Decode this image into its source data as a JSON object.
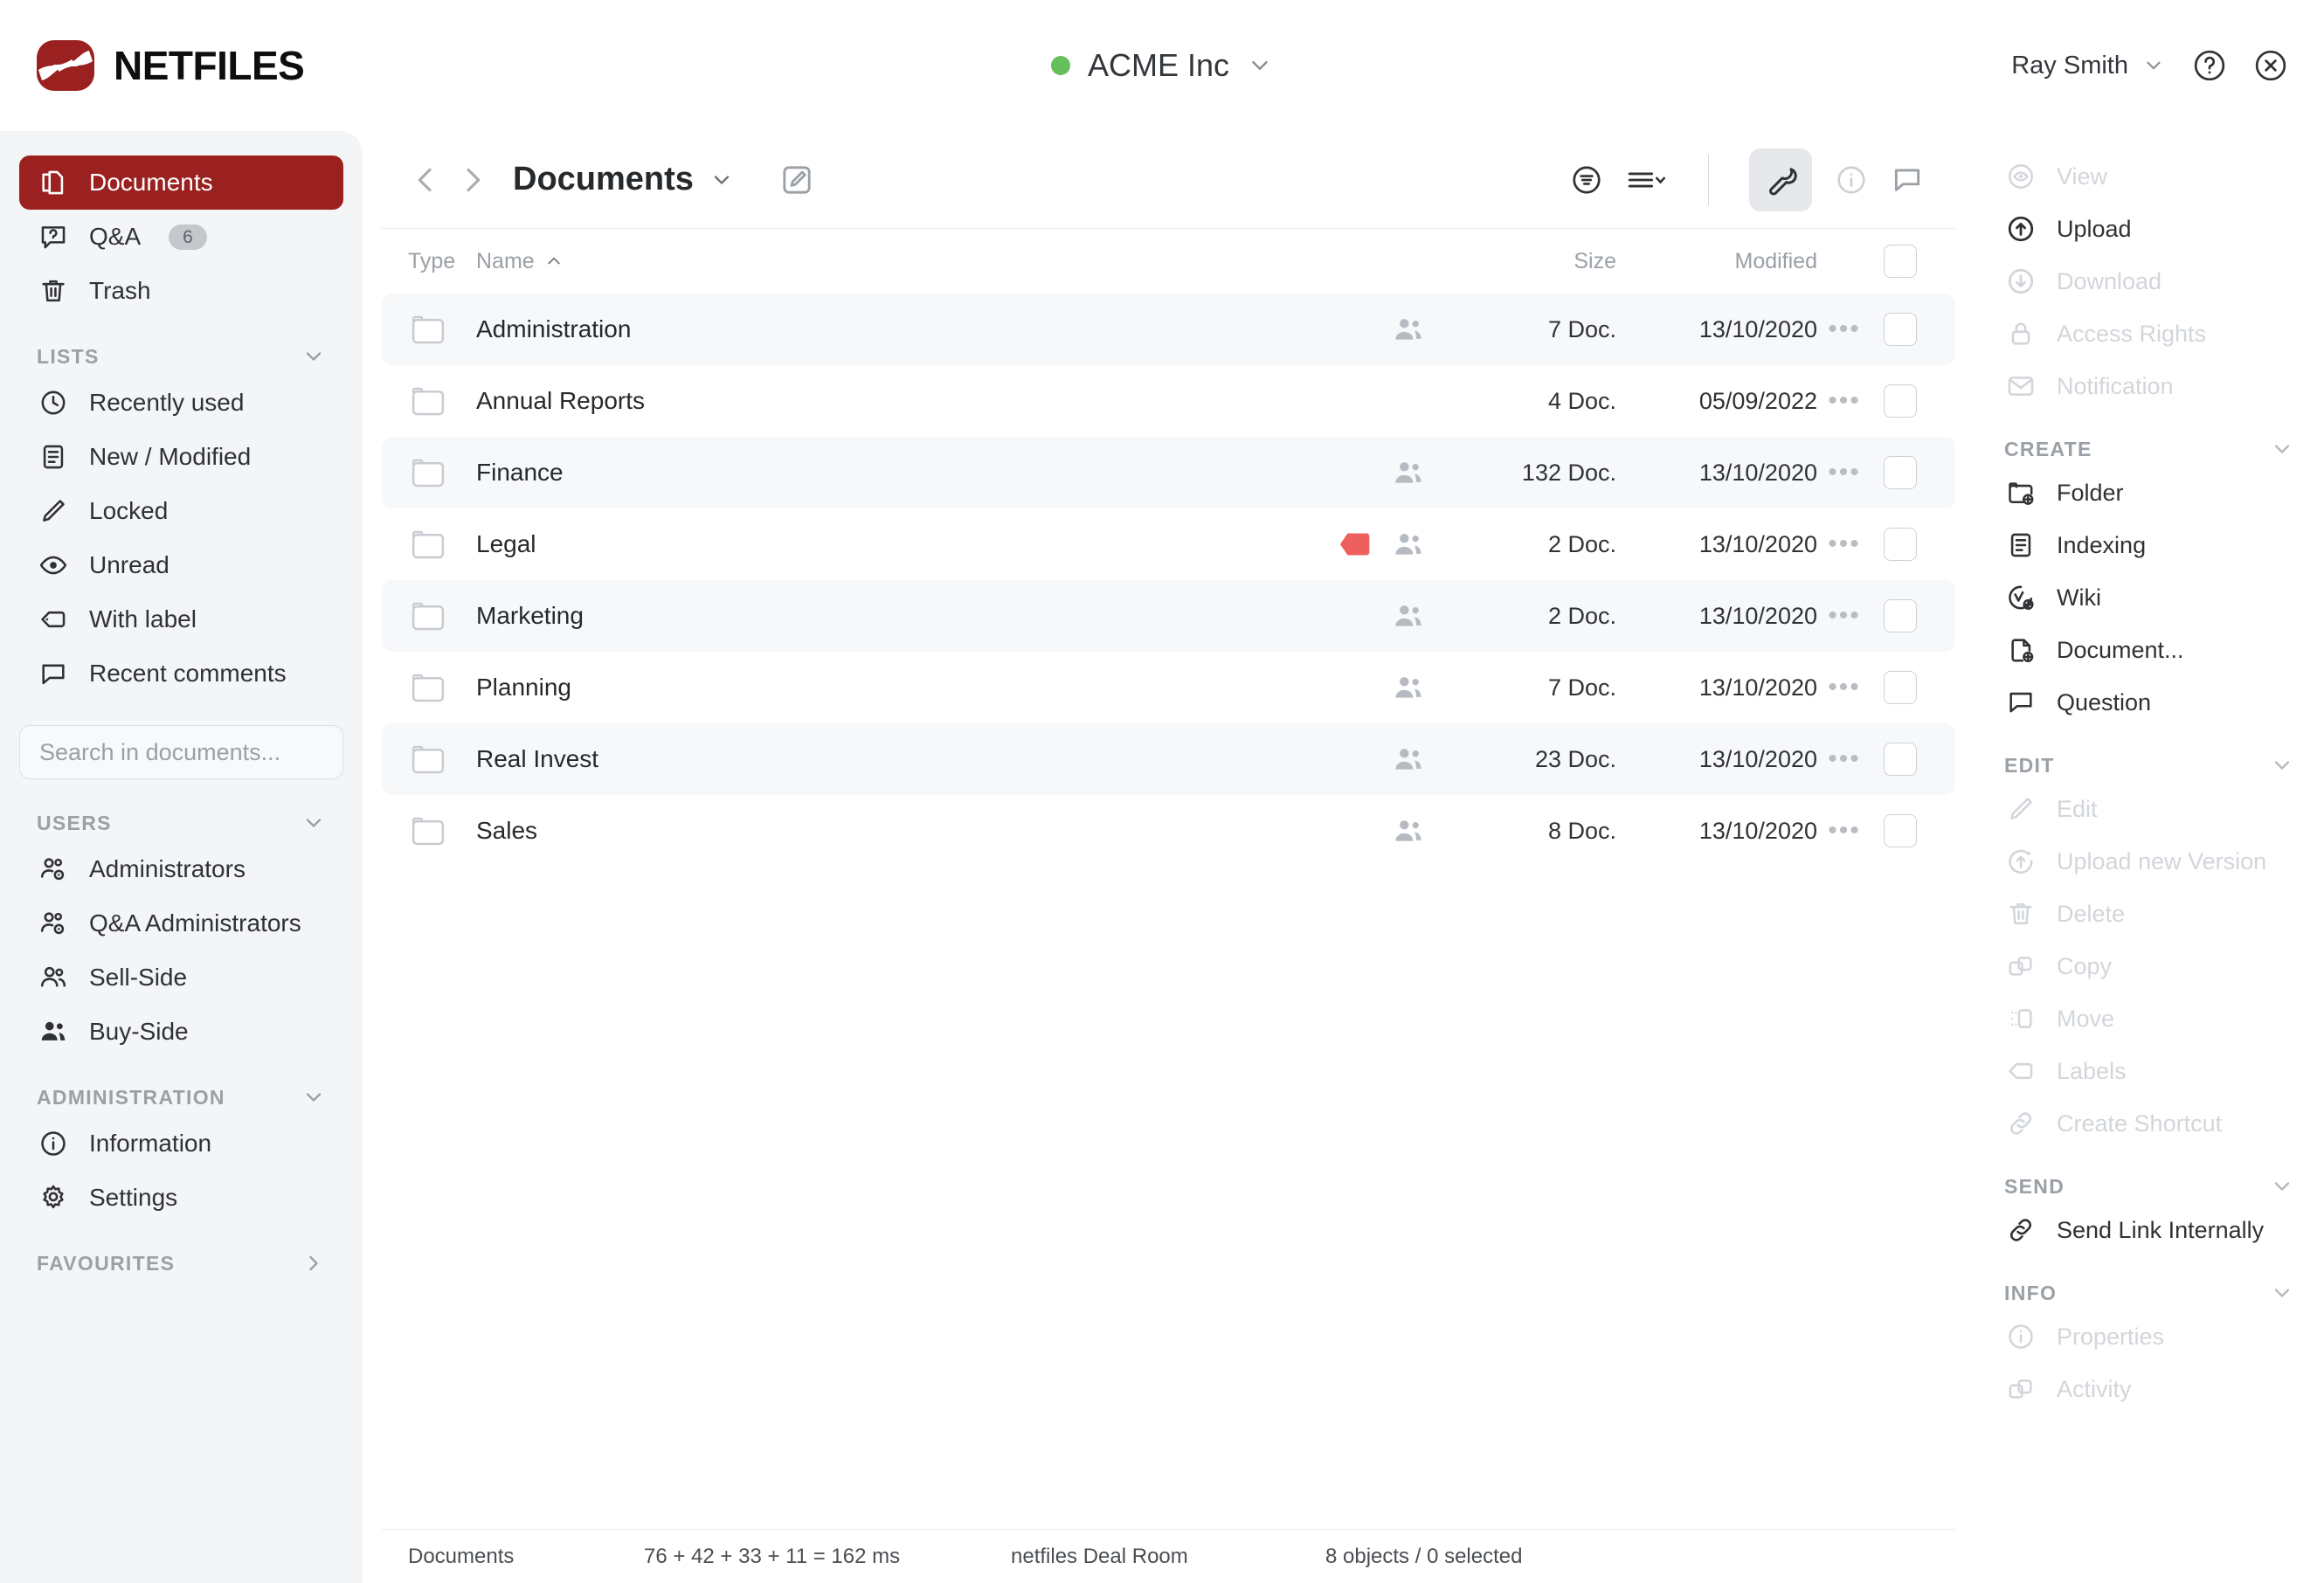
{
  "brand": {
    "name": "NETFILES",
    "logo_color": "#9b2121"
  },
  "header": {
    "room": {
      "name": "ACME Inc",
      "status_color": "#64bf5c",
      "chevron": "chevron-down-icon"
    },
    "user": {
      "name": "Ray Smith"
    },
    "help_icon": "help-circle-icon",
    "close_icon": "close-circle-icon"
  },
  "sidebar": {
    "primary": [
      {
        "label": "Documents",
        "icon": "documents-icon",
        "active": true
      },
      {
        "label": "Q&A",
        "icon": "qa-icon",
        "badge": "6"
      },
      {
        "label": "Trash",
        "icon": "trash-icon"
      }
    ],
    "groups": [
      {
        "title": "LISTS",
        "collapsed": false,
        "items": [
          {
            "label": "Recently used",
            "icon": "clock-icon"
          },
          {
            "label": "New / Modified",
            "icon": "document-lines-icon"
          },
          {
            "label": "Locked",
            "icon": "pencil-icon"
          },
          {
            "label": "Unread",
            "icon": "eye-icon"
          },
          {
            "label": "With label",
            "icon": "tag-icon"
          },
          {
            "label": "Recent comments",
            "icon": "comment-icon"
          }
        ]
      },
      {
        "title": "USERS",
        "collapsed": false,
        "items": [
          {
            "label": "Administrators",
            "icon": "user-gear-icon"
          },
          {
            "label": "Q&A Administrators",
            "icon": "user-gear-icon"
          },
          {
            "label": "Sell-Side",
            "icon": "users-outline-icon"
          },
          {
            "label": "Buy-Side",
            "icon": "users-filled-icon"
          }
        ]
      },
      {
        "title": "ADMINISTRATION",
        "collapsed": false,
        "items": [
          {
            "label": "Information",
            "icon": "info-circle-icon"
          },
          {
            "label": "Settings",
            "icon": "gear-icon"
          }
        ]
      },
      {
        "title": "FAVOURITES",
        "collapsed": true,
        "items": []
      }
    ],
    "search": {
      "placeholder": "Search in documents...",
      "value": ""
    }
  },
  "toolbar": {
    "back_icon": "chevron-left-icon",
    "forward_icon": "chevron-right-icon",
    "title": "Documents",
    "title_chevron": "chevron-down-icon",
    "edit_icon": "edit-square-icon",
    "filter_icon": "filter-circle-icon",
    "view_icon": "list-view-icon",
    "tools": [
      {
        "icon": "wrench-icon",
        "active": true
      },
      {
        "icon": "info-circle-icon",
        "active": false
      },
      {
        "icon": "comment-icon",
        "active": false
      }
    ]
  },
  "table": {
    "columns": {
      "type": "Type",
      "name": "Name",
      "size": "Size",
      "modified": "Modified"
    },
    "sort": {
      "column": "Name",
      "direction": "asc",
      "icon": "caret-up-icon"
    },
    "select_all": false,
    "rows": [
      {
        "type_icon": "folder-icon",
        "name": "Administration",
        "label": null,
        "shared": true,
        "size": "7 Doc.",
        "modified": "13/10/2020",
        "checked": false
      },
      {
        "type_icon": "folder-icon",
        "name": "Annual Reports",
        "label": null,
        "shared": false,
        "size": "4 Doc.",
        "modified": "05/09/2022",
        "checked": false
      },
      {
        "type_icon": "folder-icon",
        "name": "Finance",
        "label": null,
        "shared": true,
        "size": "132 Doc.",
        "modified": "13/10/2020",
        "checked": false
      },
      {
        "type_icon": "folder-icon",
        "name": "Legal",
        "label": "#ee6060",
        "shared": true,
        "size": "2 Doc.",
        "modified": "13/10/2020",
        "checked": false
      },
      {
        "type_icon": "folder-icon",
        "name": "Marketing",
        "label": null,
        "shared": true,
        "size": "2 Doc.",
        "modified": "13/10/2020",
        "checked": false
      },
      {
        "type_icon": "folder-icon",
        "name": "Planning",
        "label": null,
        "shared": true,
        "size": "7 Doc.",
        "modified": "13/10/2020",
        "checked": false
      },
      {
        "type_icon": "folder-icon",
        "name": "Real Invest",
        "label": null,
        "shared": true,
        "size": "23 Doc.",
        "modified": "13/10/2020",
        "checked": false
      },
      {
        "type_icon": "folder-icon",
        "name": "Sales",
        "label": null,
        "shared": true,
        "size": "8 Doc.",
        "modified": "13/10/2020",
        "checked": false
      }
    ],
    "row_more_icon": "more-horizontal-icon"
  },
  "actions": {
    "top": [
      {
        "label": "View",
        "icon": "eye-circle-icon",
        "enabled": false
      },
      {
        "label": "Upload",
        "icon": "upload-circle-icon",
        "enabled": true
      },
      {
        "label": "Download",
        "icon": "download-circle-icon",
        "enabled": false
      },
      {
        "label": "Access Rights",
        "icon": "lock-icon",
        "enabled": false
      },
      {
        "label": "Notification",
        "icon": "envelope-icon",
        "enabled": false
      }
    ],
    "sections": [
      {
        "title": "CREATE",
        "items": [
          {
            "label": "Folder",
            "icon": "folder-plus-icon",
            "enabled": true
          },
          {
            "label": "Indexing",
            "icon": "document-lines-icon",
            "enabled": true
          },
          {
            "label": "Wiki",
            "icon": "wiki-plus-icon",
            "enabled": true
          },
          {
            "label": "Document...",
            "icon": "file-plus-icon",
            "enabled": true
          },
          {
            "label": "Question",
            "icon": "comment-icon",
            "enabled": true
          }
        ]
      },
      {
        "title": "EDIT",
        "items": [
          {
            "label": "Edit",
            "icon": "pencil-icon",
            "enabled": false
          },
          {
            "label": "Upload new Version",
            "icon": "upload-version-icon",
            "enabled": false
          },
          {
            "label": "Delete",
            "icon": "trash-icon",
            "enabled": false
          },
          {
            "label": "Copy",
            "icon": "copy-icon",
            "enabled": false
          },
          {
            "label": "Move",
            "icon": "move-icon",
            "enabled": false
          },
          {
            "label": "Labels",
            "icon": "tag-icon",
            "enabled": false
          },
          {
            "label": "Create Shortcut",
            "icon": "link-icon",
            "enabled": false
          }
        ]
      },
      {
        "title": "SEND",
        "items": [
          {
            "label": "Send Link Internally",
            "icon": "link-icon",
            "enabled": true
          }
        ]
      },
      {
        "title": "INFO",
        "items": [
          {
            "label": "Properties",
            "icon": "info-circle-icon",
            "enabled": false
          },
          {
            "label": "Activity",
            "icon": "copy-icon",
            "enabled": false
          }
        ]
      }
    ]
  },
  "footer": {
    "location": "Documents",
    "timing": "76 + 42 + 33 + 11 = 162 ms",
    "product": "netfiles Deal Room",
    "selection": "8 objects / 0 selected"
  }
}
